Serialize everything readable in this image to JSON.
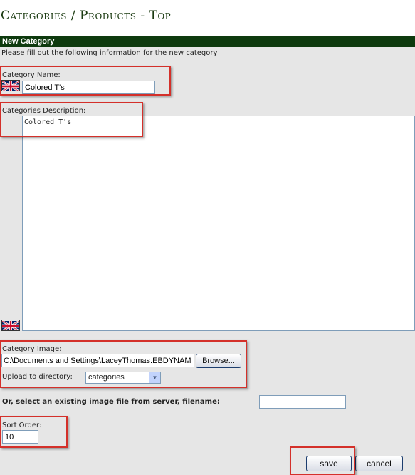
{
  "page": {
    "title": "Categories / Products - Top"
  },
  "panel": {
    "header": "New Category",
    "intro": "Please fill out the following information for the new category"
  },
  "category_name": {
    "label": "Category Name:",
    "value": "Colored T's"
  },
  "description": {
    "label": "Categories Description:",
    "value": "Colored T's"
  },
  "image": {
    "label": "Category Image:",
    "path_value": "C:\\Documents and Settings\\LaceyThomas.EBDYNAMIC",
    "browse_label": "Browse...",
    "upload_label": "Upload to directory:",
    "directory_selected": "categories"
  },
  "existing_file": {
    "label": "Or, select an existing image file from server, filename:",
    "value": ""
  },
  "sort_order": {
    "label": "Sort Order:",
    "value": "10"
  },
  "actions": {
    "save_label": "save",
    "cancel_label": "cancel"
  },
  "icons": {
    "language_flag": "uk-flag-icon",
    "dropdown": "chevron-down-icon"
  },
  "colors": {
    "header_bg": "#0e3a0e",
    "highlight": "#d4302a",
    "panel_bg": "#e6e6e6"
  }
}
